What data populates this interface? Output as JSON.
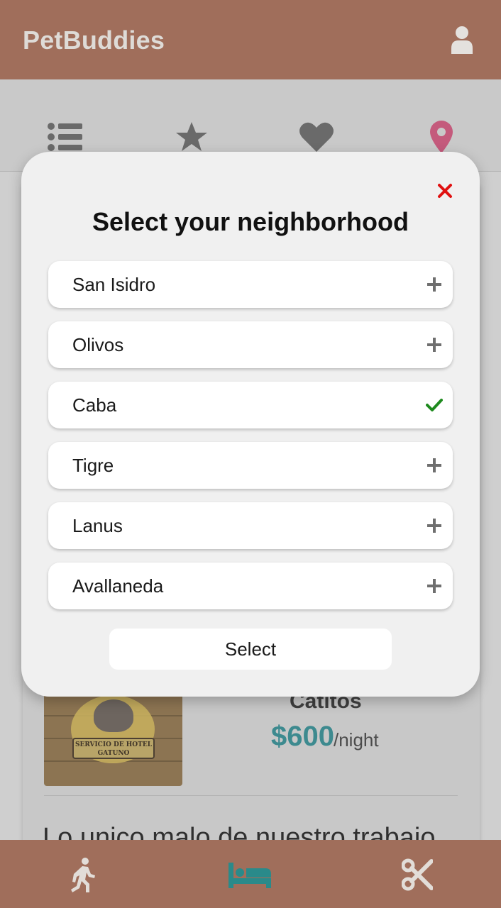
{
  "app": {
    "title": "PetBuddies"
  },
  "header": {
    "user_icon": "user-icon"
  },
  "tabs": [
    {
      "icon": "list-icon",
      "color": "#6a6a6a"
    },
    {
      "icon": "star-icon",
      "color": "#6a6a6a"
    },
    {
      "icon": "heart-icon",
      "color": "#6a6a6a"
    },
    {
      "icon": "location-pin-icon",
      "color": "#c45a7c"
    }
  ],
  "background_listing": {
    "image_text": "SERVICIO DE HOTEL GATUNO",
    "name": "Catitos",
    "price": "$600",
    "price_unit": "/night",
    "review_excerpt": "Lo unico malo de nuestro trabajo"
  },
  "modal": {
    "title": "Select your neighborhood",
    "options": [
      {
        "label": "San Isidro",
        "selected": false
      },
      {
        "label": "Olivos",
        "selected": false
      },
      {
        "label": "Caba",
        "selected": true
      },
      {
        "label": "Tigre",
        "selected": false
      },
      {
        "label": "Lanus",
        "selected": false
      },
      {
        "label": "Avallaneda",
        "selected": false
      }
    ],
    "select_label": "Select"
  },
  "bottom_nav": [
    {
      "icon": "walking-icon"
    },
    {
      "icon": "bed-icon",
      "active": true
    },
    {
      "icon": "scissors-icon"
    }
  ],
  "colors": {
    "brand": "#a06e5b",
    "accent": "#3d8a8f",
    "check": "#1e8a1e",
    "close": "#e01010",
    "pin": "#c45a7c"
  }
}
